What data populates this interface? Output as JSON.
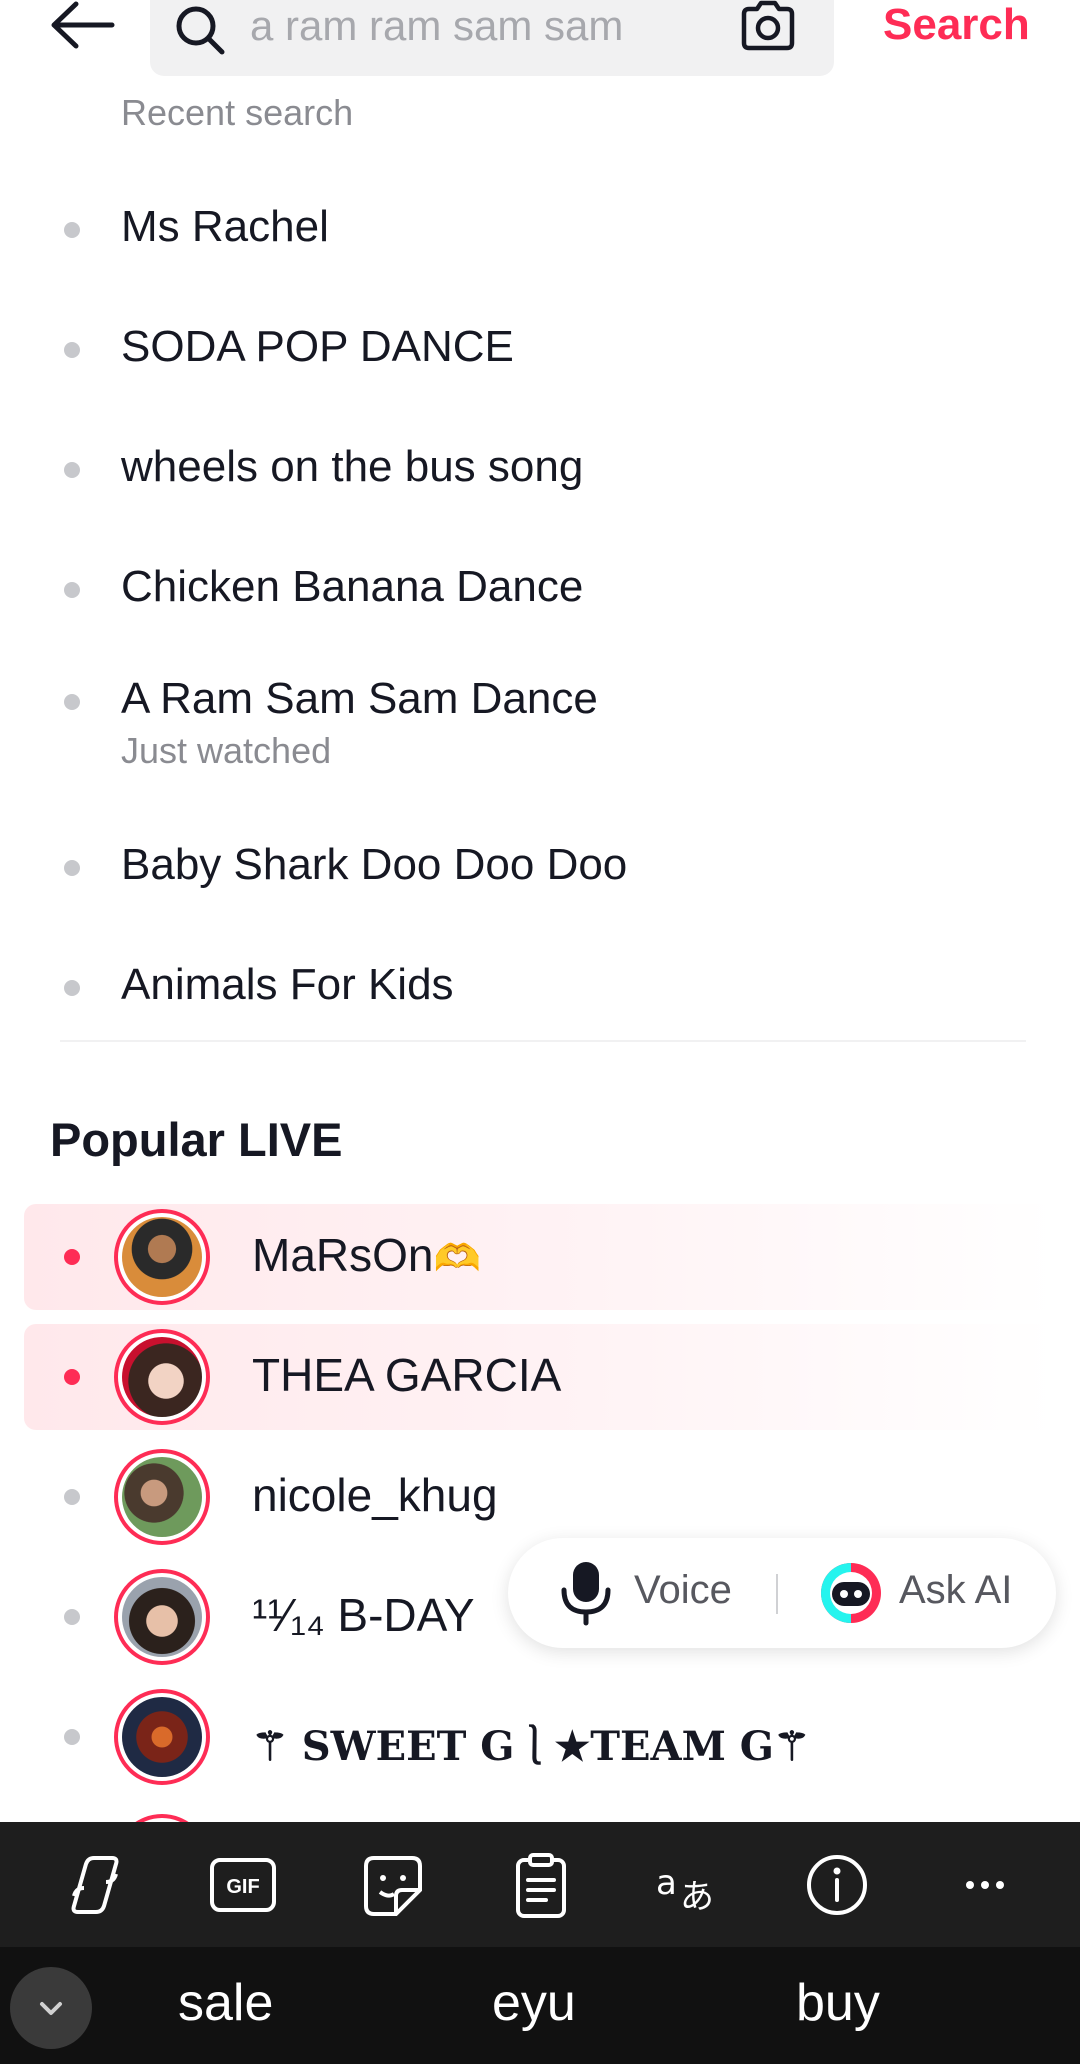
{
  "header": {
    "search_query": "a ram ram sam sam",
    "search_action": "Search"
  },
  "recent": {
    "label": "Recent search",
    "items": [
      {
        "text": "Ms Rachel"
      },
      {
        "text": "SODA POP DANCE"
      },
      {
        "text": "wheels on the bus song"
      },
      {
        "text": "Chicken Banana Dance"
      },
      {
        "text": "A Ram Sam Sam Dance",
        "sub": "Just watched"
      },
      {
        "text": "Baby Shark Doo Doo Doo"
      },
      {
        "text": "Animals For Kids"
      }
    ]
  },
  "popular_live": {
    "title": "Popular LIVE",
    "items": [
      {
        "name": "MaRsOn",
        "emoji": "🫶",
        "live": true
      },
      {
        "name": "THEA GARCIA",
        "live": true
      },
      {
        "name": "nicole_khug",
        "live": false
      },
      {
        "name": "¹¹⁄₁₄ B-DAY",
        "live": false
      },
      {
        "name": "⚚ SWEET G⎱★TEAM G⚚",
        "live": false
      }
    ]
  },
  "floating": {
    "voice_label": "Voice",
    "ask_ai_label": "Ask AI"
  },
  "keyboard": {
    "suggestions": [
      "sale",
      "eyu",
      "buy"
    ],
    "tools": [
      "copilot-icon",
      "gif-icon",
      "sticker-icon",
      "clipboard-icon",
      "translate-icon",
      "info-icon",
      "more-icon"
    ]
  },
  "colors": {
    "accent": "#fe2c55",
    "text": "#161823",
    "muted": "#8a8b91"
  }
}
